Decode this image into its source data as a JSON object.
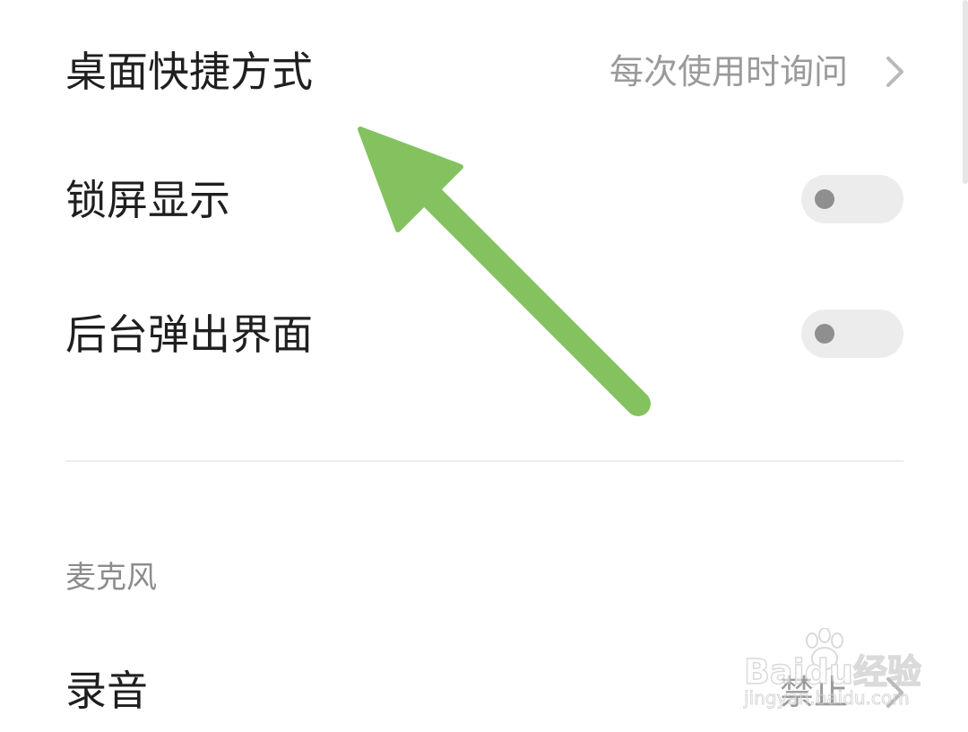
{
  "settings": {
    "desktop_shortcut": {
      "label": "桌面快捷方式",
      "value": "每次使用时询问"
    },
    "lock_screen_display": {
      "label": "锁屏显示",
      "enabled": false
    },
    "background_popup": {
      "label": "后台弹出界面",
      "enabled": false
    }
  },
  "microphone_section": {
    "header": "麦克风",
    "recording": {
      "label": "录音",
      "value": "禁止"
    }
  },
  "watermark": {
    "logo": "Baidu经验",
    "url": "jingyan.baidu.com"
  },
  "colors": {
    "annotation_arrow": "#84c25f",
    "toggle_track": "#ececec",
    "toggle_knob": "#8f8f8f",
    "secondary_text": "#9a9a9a"
  }
}
